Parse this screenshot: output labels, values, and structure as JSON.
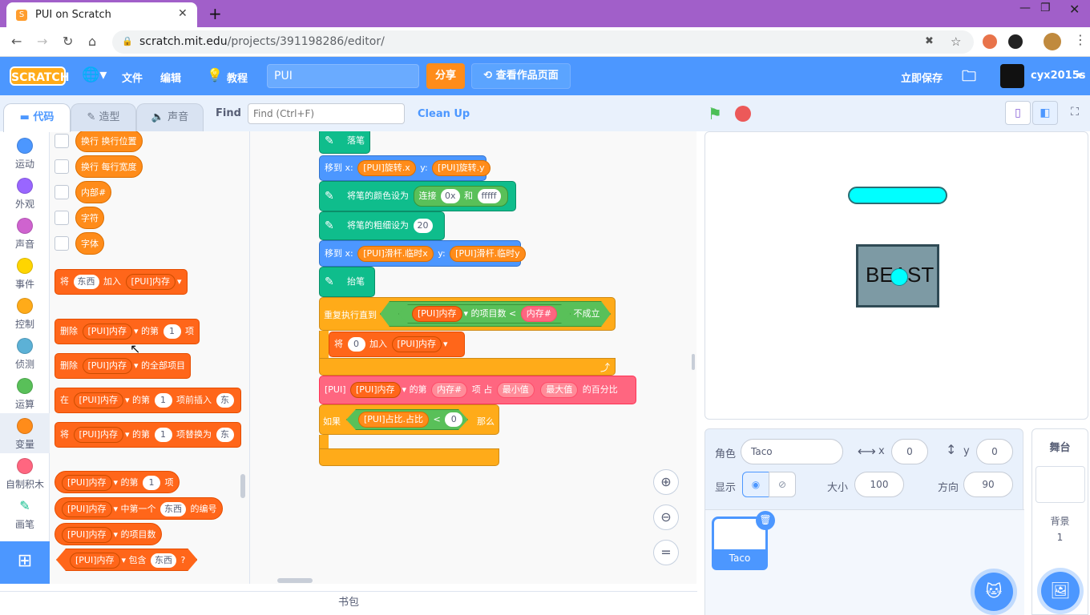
{
  "browser": {
    "tab_title": "PUI on Scratch",
    "url_host": "scratch.mit.edu",
    "url_path": "/projects/391198286/editor/"
  },
  "menu": {
    "logo": "SCRATCH",
    "file": "文件",
    "edit": "编辑",
    "tutorials": "教程",
    "project_title": "PUI",
    "share": "分享",
    "see_project_page": "查看作品页面",
    "save_now": "立即保存",
    "username": "cyx2015s"
  },
  "editor_tabs": {
    "code": "代码",
    "costumes": "造型",
    "sounds": "声音"
  },
  "find": {
    "label": "Find",
    "placeholder": "Find (Ctrl+F)",
    "cleanup": "Clean Up"
  },
  "categories": [
    {
      "label": "运动",
      "color": "#4c97ff"
    },
    {
      "label": "外观",
      "color": "#9966ff"
    },
    {
      "label": "声音",
      "color": "#cf63cf"
    },
    {
      "label": "事件",
      "color": "#ffd500"
    },
    {
      "label": "控制",
      "color": "#ffab19"
    },
    {
      "label": "侦测",
      "color": "#5cb1d6"
    },
    {
      "label": "运算",
      "color": "#59c059"
    },
    {
      "label": "变量",
      "color": "#ff8c1a"
    },
    {
      "label": "自制积木",
      "color": "#ff6680"
    },
    {
      "label": "画笔",
      "color": "#0fbd8c"
    }
  ],
  "palette": {
    "vars": [
      "换行 换行位置",
      "换行 每行宽度",
      "内部#",
      "字符",
      "字体"
    ],
    "list_name": "[PUI]内存",
    "add": {
      "a": "将",
      "item": "东西",
      "b": "加入"
    },
    "del": {
      "a": "删除",
      "b": "的第",
      "n": "1",
      "c": "项"
    },
    "delall": {
      "a": "删除",
      "b": "的全部项目"
    },
    "ins": {
      "a": "在",
      "b": "的第",
      "n": "1",
      "c": "项前插入",
      "d": "东"
    },
    "rep": {
      "a": "将",
      "b": "的第",
      "n": "1",
      "c": "项替换为",
      "d": "东"
    },
    "item": {
      "b": "的第",
      "n": "1",
      "c": "项"
    },
    "itemnum": {
      "b": "中第一个",
      "v": "东西",
      "c": "的编号"
    },
    "len": {
      "b": "的项目数"
    },
    "contains": {
      "b": "包含",
      "v": "东西",
      "c": "?"
    }
  },
  "script": {
    "pen_down": "落笔",
    "goto1": {
      "a": "移到 x:",
      "x": "[PUI]旋转.x",
      "b": "y:",
      "y": "[PUI]旋转.y"
    },
    "pen_color": {
      "a": "将笔的颜色设为",
      "join": "连接",
      "v1": "0x",
      "and": "和",
      "v2": "fffff"
    },
    "pen_size": {
      "a": "将笔的粗细设为",
      "v": "20"
    },
    "goto2": {
      "a": "移到 x:",
      "x": "[PUI]滑杆.临时x",
      "b": "y:",
      "y": "[PUI]滑杆.临时y"
    },
    "pen_up": "抬笔",
    "repeat_until": {
      "a": "重复执行直到",
      "list": "[PUI]内存",
      "len": "的项目数",
      "lt": "<",
      "v": "内存#",
      "not": "不成立"
    },
    "add_inner": {
      "a": "将",
      "v": "0",
      "b": "加入",
      "list": "[PUI]内存"
    },
    "custom": {
      "a": "[PUI]",
      "list": "[PUI]内存",
      "b": "的第",
      "v": "内存#",
      "c": "项",
      "d": "占",
      "min": "最小值",
      "max": "最大值",
      "e": "的百分比"
    },
    "if": {
      "a": "如果",
      "v": "[PUI]占比.占比",
      "lt": "<",
      "n": "0",
      "b": "那么"
    }
  },
  "stage": {
    "sprite_text": "BEAST",
    "bar_color": "#00ffff",
    "box_color": "#7d9aa4"
  },
  "sprite_info": {
    "sprite_label": "角色",
    "sprite_name": "Taco",
    "x_label": "x",
    "x": "0",
    "y_label": "y",
    "y": "0",
    "show_label": "显示",
    "size_label": "大小",
    "size": "100",
    "dir_label": "方向",
    "dir": "90"
  },
  "sprites": [
    {
      "name": "Taco"
    }
  ],
  "stage_panel": {
    "title": "舞台",
    "backdrops_label": "背景",
    "backdrop_count": "1"
  },
  "backpack": "书包"
}
